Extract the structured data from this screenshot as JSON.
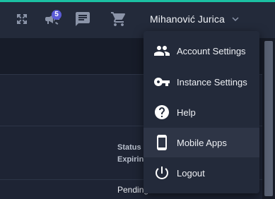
{
  "colors": {
    "accent": "#1bc0a3",
    "badge": "#5b5bd6",
    "icon": "#8b94a8",
    "menu_icon": "#ffffff"
  },
  "topbar": {
    "icons": [
      "fullscreen-icon",
      "announcements-icon",
      "messages-icon",
      "cart-icon"
    ],
    "announcements_badge": "5",
    "user_name": "Mihanović Jurica"
  },
  "user_menu": {
    "items": [
      {
        "label": "Account Settings",
        "icon": "account-settings-icon"
      },
      {
        "label": "Instance Settings",
        "icon": "key-icon"
      },
      {
        "label": "Help",
        "icon": "help-icon"
      },
      {
        "label": "Mobile Apps",
        "icon": "mobile-phone-icon"
      },
      {
        "label": "Logout",
        "icon": "power-icon"
      }
    ],
    "highlighted_item": "Mobile Apps"
  },
  "background": {
    "status_label": "Status",
    "expiring_label": "Expiring",
    "pending_value": "Pending"
  }
}
